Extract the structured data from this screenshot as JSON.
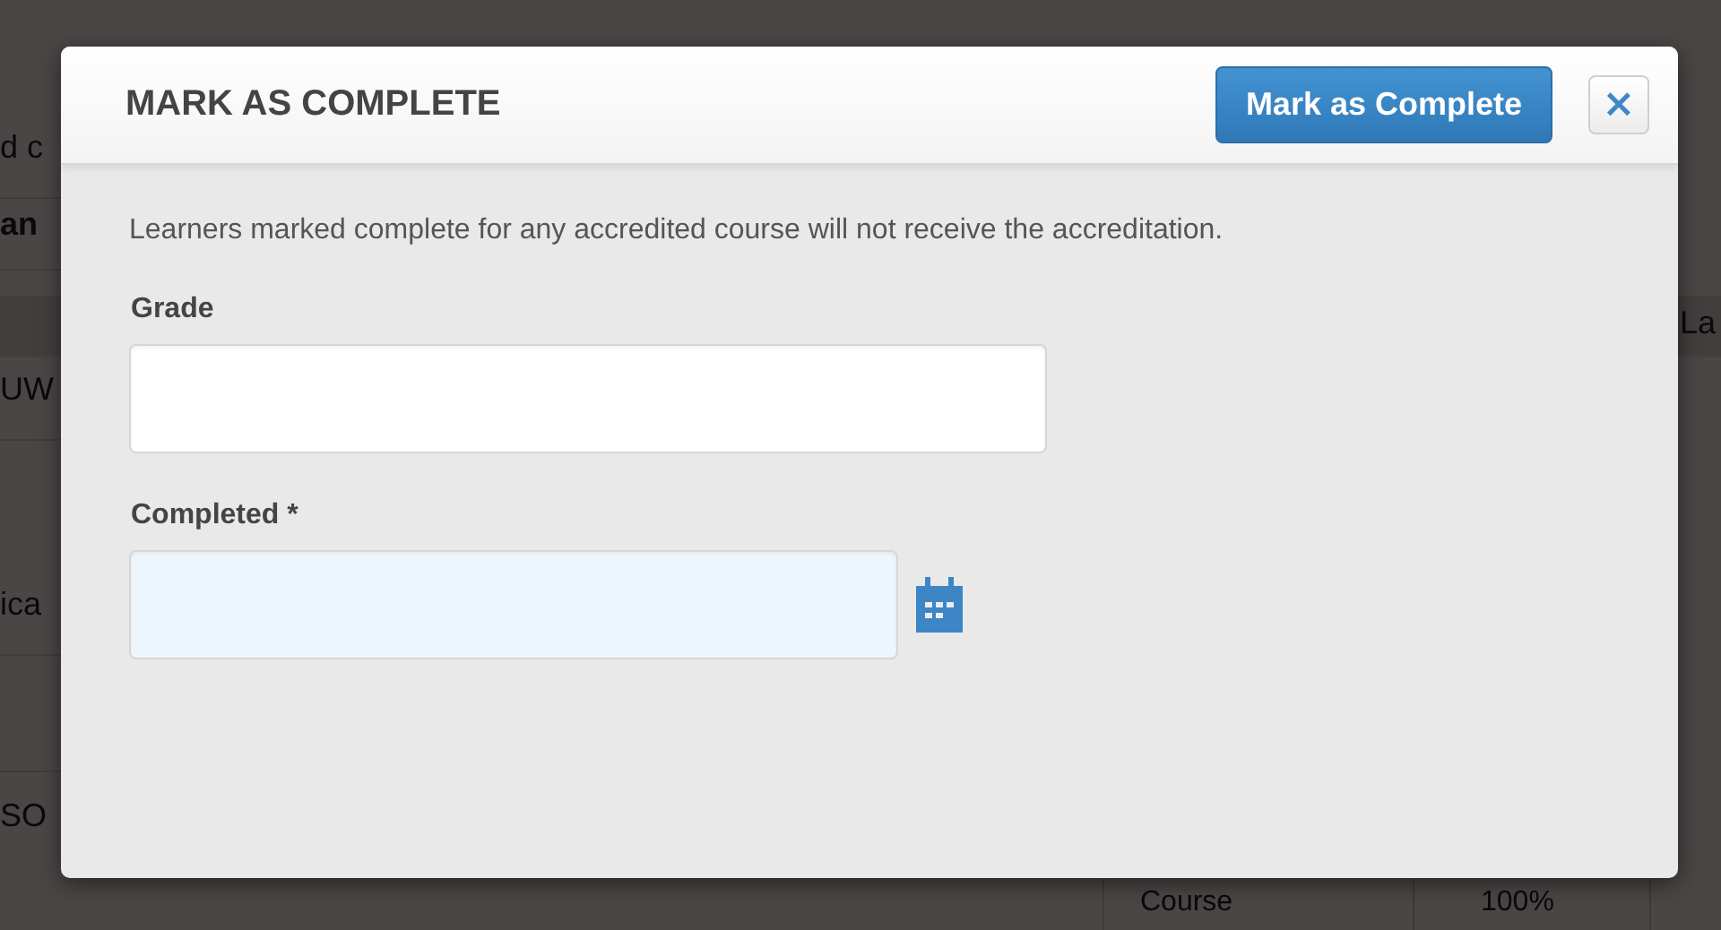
{
  "background": {
    "left_cells": [
      "d c",
      "an",
      "UW",
      "ica",
      "SO"
    ],
    "right_header": "La",
    "bottom_cells": [
      "Course",
      "100%"
    ]
  },
  "dialog": {
    "title": "MARK AS COMPLETE",
    "primary_button": "Mark as Complete",
    "close_button": "×",
    "message": "Learners marked complete for any accredited course will not receive the accreditation.",
    "fields": [
      {
        "label": "Grade",
        "kind": "text"
      },
      {
        "label": "Completed",
        "required_mark": "*",
        "kind": "date"
      }
    ]
  }
}
